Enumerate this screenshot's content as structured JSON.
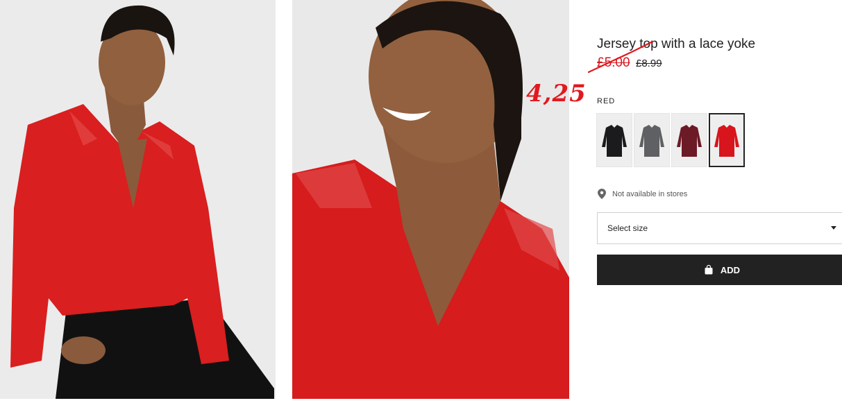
{
  "product": {
    "title": "Jersey top with a lace yoke",
    "sale_price": "£5.00",
    "original_price": "£8.99",
    "handwritten_note": "4,25",
    "color_label": "RED",
    "availability": "Not available in stores",
    "size_select_placeholder": "Select size",
    "add_label": "ADD"
  },
  "swatches": [
    {
      "name": "black",
      "color": "#1b1b1d"
    },
    {
      "name": "grey",
      "color": "#5f6063"
    },
    {
      "name": "burgundy",
      "color": "#6b1a26"
    },
    {
      "name": "red",
      "color": "#d8141c",
      "selected": true
    }
  ],
  "colors": {
    "accent_red": "#d41a21",
    "button_bg": "#222222"
  }
}
